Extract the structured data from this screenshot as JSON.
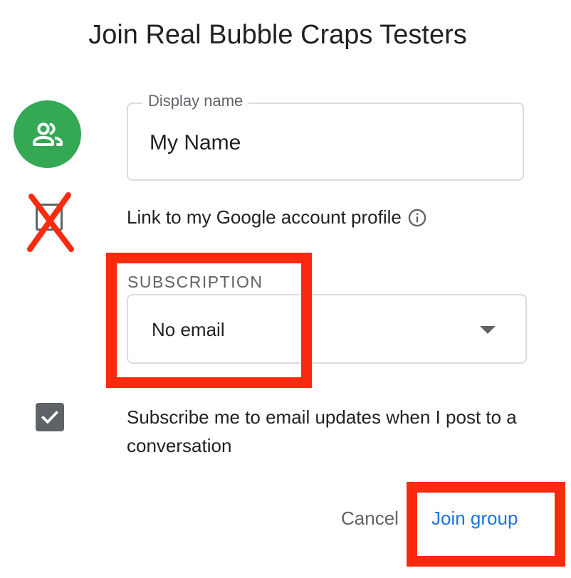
{
  "dialog": {
    "title": "Join Real Bubble Craps Testers"
  },
  "display_name": {
    "label": "Display name",
    "value": "My Name"
  },
  "link_profile": {
    "label": "Link to my Google account profile",
    "checked": false
  },
  "subscription": {
    "section_label": "SUBSCRIPTION",
    "selected": "No email"
  },
  "subscribe_updates": {
    "label": "Subscribe me to email updates when I post to a conversation",
    "checked": true
  },
  "actions": {
    "cancel_label": "Cancel",
    "join_label": "Join group"
  },
  "icons": {
    "avatar": "group-icon",
    "info": "info-icon",
    "dropdown": "dropdown-arrow-icon",
    "check": "checkmark-icon"
  },
  "colors": {
    "avatar_bg": "#34a853",
    "accent": "#1a73e8",
    "annotation": "#fa2a0f"
  }
}
